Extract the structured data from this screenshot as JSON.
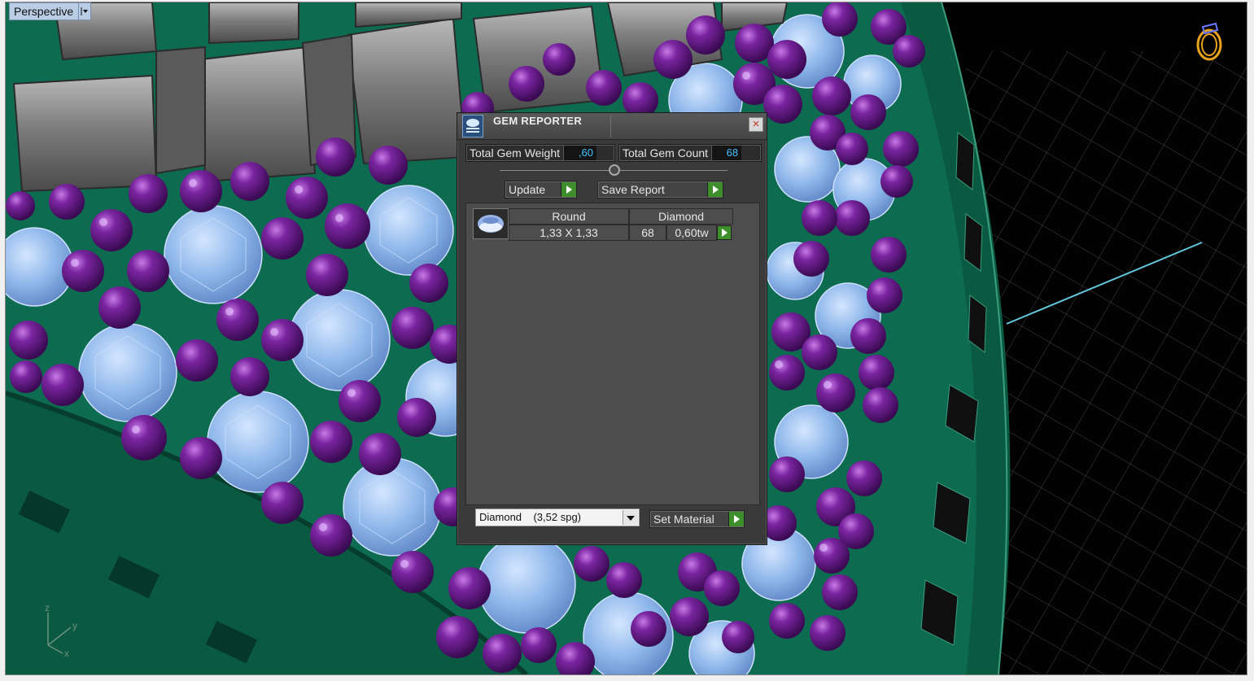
{
  "viewport": {
    "name": "Perspective",
    "dropdown_glyph": "▾"
  },
  "gem_reporter": {
    "title": "GEM REPORTER",
    "close_glyph": "×",
    "total_weight_label": "Total Gem Weight",
    "total_weight_value": ",60",
    "total_count_label": "Total Gem Count",
    "total_count_value": "68",
    "update_label": "Update",
    "save_report_label": "Save Report",
    "table": {
      "shape": "Round",
      "stone": "Diamond",
      "size": "1,33 X 1,33",
      "count": "68",
      "weight": "0,60tw"
    },
    "material": "Diamond    (3,52 spg)",
    "set_material_label": "Set Material"
  },
  "axis_labels": {
    "z": "z",
    "y": "y",
    "x": "x"
  },
  "icons": [
    "dropdown-arrow-icon",
    "ring-icon",
    "gem-reporter-app-icon",
    "close-icon",
    "go-arrow-icon",
    "round-gem-icon",
    "axis-icon"
  ],
  "colors": {
    "metal_green": "#0d6b4f",
    "gem_blue": "#8cb8ec",
    "purple": "#6d1d8c",
    "accent_value": "#45c1ff",
    "go_green": "#3e8e2b"
  }
}
